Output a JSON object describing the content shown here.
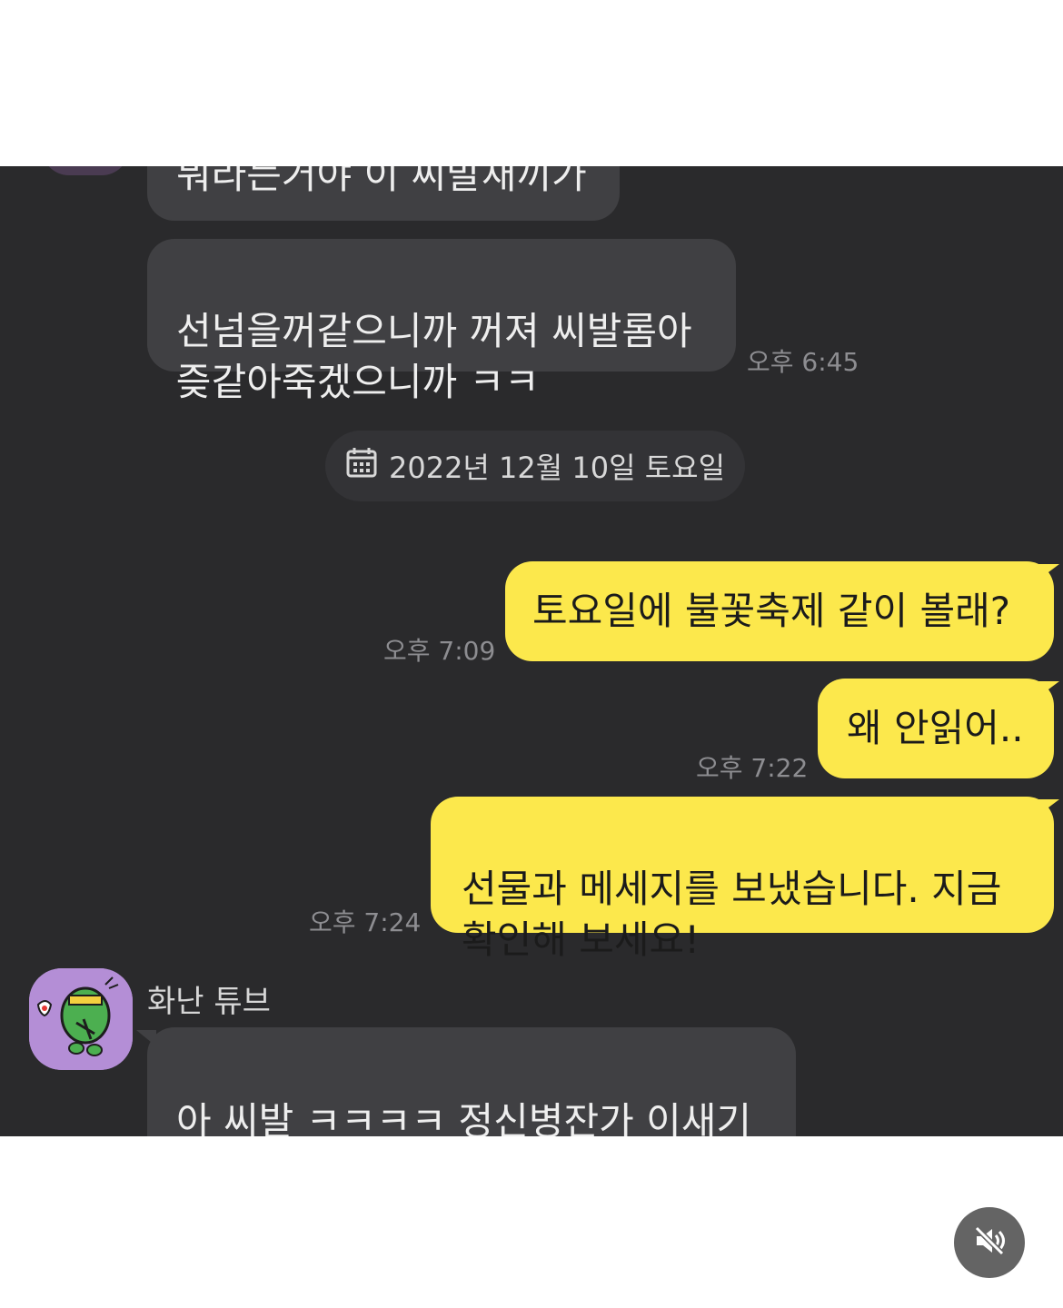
{
  "messages": {
    "m1": "뭐라는거야 이 씨발새끼가",
    "m2": "선넘을꺼같으니까 꺼져 씨발롬아\n즞같아죽겠으니까 ㅋㅋ",
    "m2_time": "오후 6:45",
    "date_separator": "2022년 12월 10일 토요일",
    "m3": "토요일에 불꽃축제 같이 볼래?",
    "m3_time": "오후 7:09",
    "m4": "왜 안읽어..",
    "m4_time": "오후 7:22",
    "m5": "선물과 메세지를 보냈습니다. 지금\n확인해 보세요!",
    "m5_time": "오후 7:24",
    "sender_name": "화난 튜브",
    "m6": "아 씨발 ㅋㅋㅋㅋ 정신병잔가 이새기\n진심으로 ㅋㅋ"
  },
  "icons": {
    "calendar": "calendar-icon",
    "mute": "speaker-muted-icon",
    "avatar": "angry-tube-avatar"
  },
  "colors": {
    "chat_background": "#2a2a2c",
    "incoming_bubble": "#404043",
    "outgoing_bubble": "#fce84c"
  }
}
